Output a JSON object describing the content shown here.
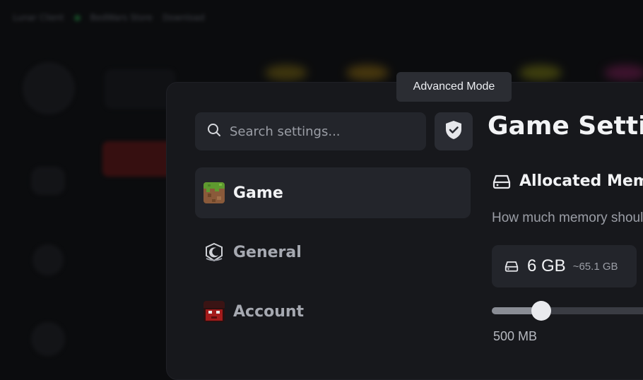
{
  "background": {
    "top_text_1": "Lunar Client",
    "top_text_2": "BedWars Store",
    "top_text_3": "Download"
  },
  "tooltip": {
    "text": "Advanced Mode"
  },
  "search": {
    "placeholder": "Search settings..."
  },
  "nav": {
    "items": [
      {
        "label": "Game",
        "active": true
      },
      {
        "label": "General",
        "active": false
      },
      {
        "label": "Account",
        "active": false
      }
    ]
  },
  "settings": {
    "title": "Game Settings",
    "section_title": "Allocated Memory",
    "description": "How much memory should be allocated to the game",
    "memory_value": "6 GB",
    "memory_approx": "~65.1 GB",
    "slider_min_label": "500 MB",
    "slider_level": 0.29
  },
  "colors": {
    "accent": "#e9eaee",
    "panel": "#17181c",
    "surface": "#23252b"
  }
}
